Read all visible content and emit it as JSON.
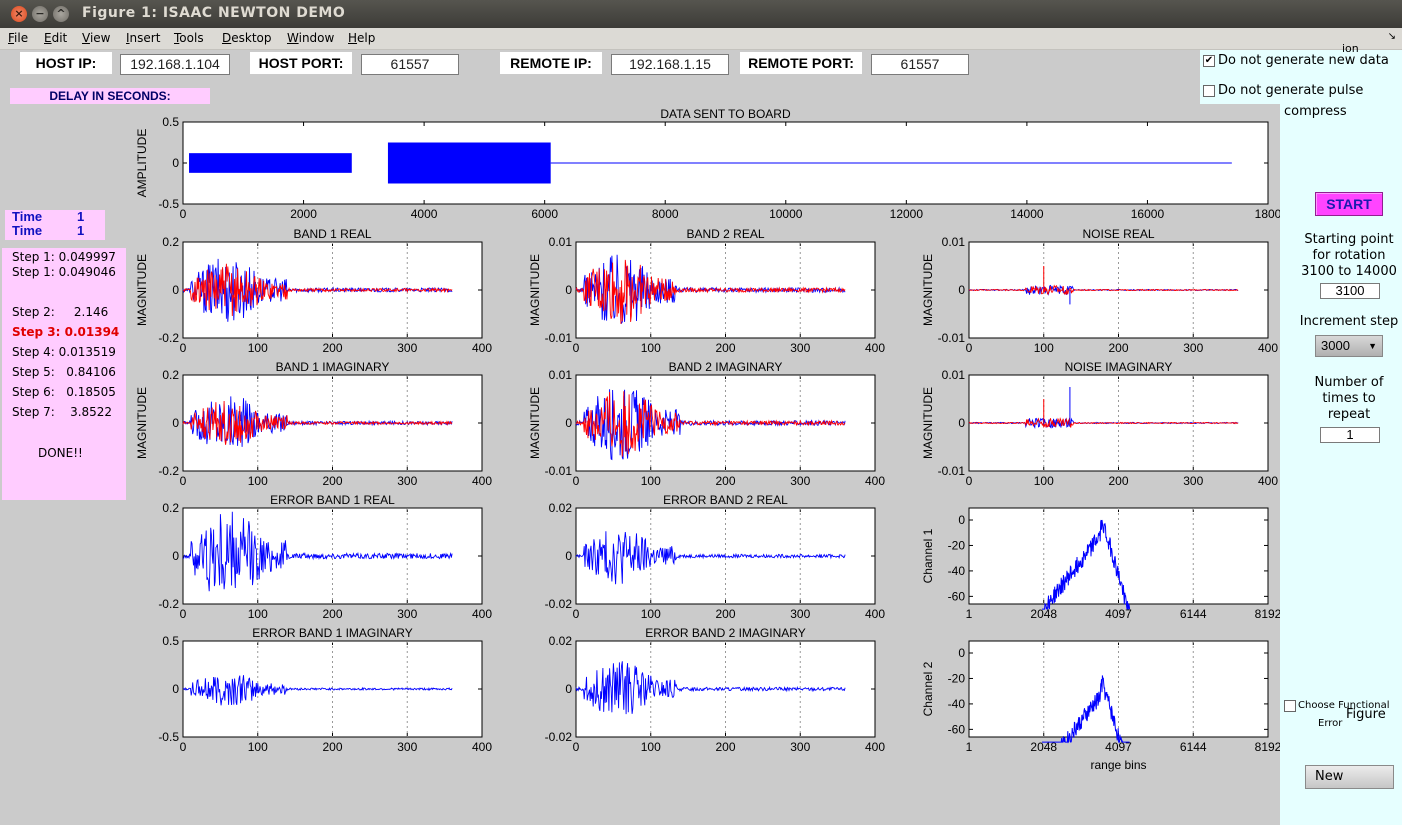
{
  "window": {
    "title": "Figure 1:  ISAAC NEWTON DEMO"
  },
  "menu": [
    "File",
    "Edit",
    "View",
    "Insert",
    "Tools",
    "Desktop",
    "Window",
    "Help"
  ],
  "network": {
    "host_ip_label": "HOST IP:",
    "host_ip": "192.168.1.104",
    "host_port_label": "HOST PORT:",
    "host_port": "61557",
    "remote_ip_label": "REMOTE IP:",
    "remote_ip": "192.168.1.15",
    "remote_port_label": "REMOTE PORT:",
    "remote_port": "61557"
  },
  "delay_label": "DELAY IN SECONDS:",
  "time": [
    {
      "label": "Time",
      "value": "1"
    },
    {
      "label": "Time",
      "value": "1"
    }
  ],
  "steps": [
    "Step 1: 0.049997",
    "Step 1: 0.049046",
    "Step 2:     2.146",
    "Step 3: 0.01394",
    "Step 4: 0.013519",
    "Step 5:   0.84106",
    "Step 6:   0.18505",
    "Step 7:    3.8522"
  ],
  "done": "DONE!!",
  "options": {
    "no_new_data": "Do not generate new data",
    "no_new_data_checked": true,
    "no_pulse": "Do not generate pulse",
    "no_pulse_checked": false,
    "compress": "compress",
    "clipped_top": "ion"
  },
  "controls": {
    "start": "START",
    "start_point_label": [
      "Starting point",
      "for rotation",
      "3100 to 14000"
    ],
    "start_point_value": "3100",
    "increment_label": "Increment step",
    "increment_value": "3000",
    "repeat_label": [
      "Number of",
      "times to",
      "repeat"
    ],
    "repeat_value": "1",
    "choose_error_label": "Choose Functional",
    "choose_error_label2": "Error",
    "figure_label": "Figure",
    "new": "New"
  },
  "chart_data": [
    {
      "type": "line",
      "title": "DATA SENT TO BOARD",
      "ylabel": "AMPLITUDE",
      "xlim": [
        0,
        18000
      ],
      "ylim": [
        -0.5,
        0.5
      ],
      "xticks": [
        "0",
        "2000",
        "4000",
        "6000",
        "8000",
        "10000",
        "12000",
        "14000",
        "16000",
        "1800"
      ],
      "yticks": [
        "0.5",
        "0",
        "-0.5"
      ],
      "series": [
        {
          "color": "#0000ff",
          "segments": [
            {
              "x": [
                100,
                2800
              ],
              "amp": 0.12
            },
            {
              "x": [
                3400,
                6100
              ],
              "amp": 0.25
            },
            {
              "x": [
                6100,
                17400
              ],
              "amp": 0.0
            }
          ]
        }
      ]
    },
    {
      "type": "line",
      "title": "BAND 1 REAL",
      "ylabel": "MAGNITUDE",
      "xlim": [
        0,
        400
      ],
      "ylim": [
        -0.2,
        0.2
      ],
      "xticks": [
        "0",
        "100",
        "200",
        "300",
        "400"
      ],
      "yticks": [
        "0.2",
        "0",
        "-0.2"
      ],
      "red_scale": 0.8,
      "burst_end": 140,
      "peak": 0.14
    },
    {
      "type": "line",
      "title": "BAND 2 REAL",
      "ylabel": "MAGNITUDE",
      "xlim": [
        0,
        400
      ],
      "ylim": [
        -0.01,
        0.01
      ],
      "xticks": [
        "0",
        "100",
        "200",
        "300",
        "400"
      ],
      "yticks": [
        "0.01",
        "0",
        "-0.01"
      ],
      "red_scale": 0.9,
      "burst_end": 135,
      "peak": 0.008
    },
    {
      "type": "line",
      "title": "NOISE REAL",
      "ylabel": "MAGNITUDE",
      "xlim": [
        0,
        400
      ],
      "ylim": [
        -0.01,
        0.01
      ],
      "xticks": [
        "0",
        "100",
        "200",
        "300",
        "400"
      ],
      "yticks": [
        "0.01",
        "0",
        "-0.01"
      ],
      "red_scale": 1.0,
      "burst_end": 0,
      "peak": 0.002
    },
    {
      "type": "line",
      "title": "BAND 1 IMAGINARY",
      "ylabel": "MAGNITUDE",
      "xlim": [
        0,
        400
      ],
      "ylim": [
        -0.2,
        0.2
      ],
      "xticks": [
        "0",
        "100",
        "200",
        "300",
        "400"
      ],
      "yticks": [
        "0.2",
        "0",
        "-0.2"
      ],
      "red_scale": 0.8,
      "burst_end": 140,
      "peak": 0.12
    },
    {
      "type": "line",
      "title": "BAND 2 IMAGINARY",
      "ylabel": "MAGNITUDE",
      "xlim": [
        0,
        400
      ],
      "ylim": [
        -0.01,
        0.01
      ],
      "xticks": [
        "0",
        "100",
        "200",
        "300",
        "400"
      ],
      "yticks": [
        "0.01",
        "0",
        "-0.01"
      ],
      "red_scale": 0.9,
      "burst_end": 140,
      "peak": 0.008
    },
    {
      "type": "line",
      "title": "NOISE IMAGINARY",
      "ylabel": "MAGNITUDE",
      "xlim": [
        0,
        400
      ],
      "ylim": [
        -0.01,
        0.01
      ],
      "xticks": [
        "0",
        "100",
        "200",
        "300",
        "400"
      ],
      "yticks": [
        "0.01",
        "0",
        "-0.01"
      ],
      "red_scale": 1.0,
      "burst_end": 0,
      "peak": 0.002
    },
    {
      "type": "line",
      "title": "ERROR BAND 1 REAL",
      "ylabel": "",
      "xlim": [
        0,
        400
      ],
      "ylim": [
        -0.2,
        0.2
      ],
      "xticks": [
        "0",
        "100",
        "200",
        "300",
        "400"
      ],
      "yticks": [
        "0.2",
        "0",
        "-0.2"
      ],
      "red_scale": 0,
      "burst_end": 140,
      "peak": 0.19
    },
    {
      "type": "line",
      "title": "ERROR BAND 2 REAL",
      "ylabel": "",
      "xlim": [
        0,
        400
      ],
      "ylim": [
        -0.02,
        0.02
      ],
      "xticks": [
        "0",
        "100",
        "200",
        "300",
        "400"
      ],
      "yticks": [
        "0.02",
        "0",
        "-0.02"
      ],
      "red_scale": 0,
      "burst_end": 135,
      "peak": 0.012
    },
    {
      "type": "line",
      "title": "Channel 1",
      "ylabel": "Channel 1",
      "xlim": [
        1,
        8192
      ],
      "ylim": [
        -70,
        5
      ],
      "xticks": [
        "1",
        "2048",
        "4097",
        "6144",
        "8192"
      ],
      "yticks": [
        "0",
        "-20",
        "-40",
        "-60"
      ],
      "spectrum": true
    },
    {
      "type": "line",
      "title": "ERROR BAND 1 IMAGINARY",
      "ylabel": "",
      "xlim": [
        0,
        400
      ],
      "ylim": [
        -0.5,
        0.5
      ],
      "xticks": [
        "0",
        "100",
        "200",
        "300",
        "400"
      ],
      "yticks": [
        "0.5",
        "0",
        "-0.5"
      ],
      "red_scale": 0,
      "burst_end": 140,
      "peak": 0.18
    },
    {
      "type": "line",
      "title": "ERROR BAND 2 IMAGINARY",
      "ylabel": "",
      "xlim": [
        0,
        400
      ],
      "ylim": [
        -0.02,
        0.02
      ],
      "xticks": [
        "0",
        "100",
        "200",
        "300",
        "400"
      ],
      "yticks": [
        "0.02",
        "0",
        "-0.02"
      ],
      "red_scale": 0,
      "burst_end": 135,
      "peak": 0.012
    },
    {
      "type": "line",
      "title": "Channel 2",
      "ylabel": "Channel 2",
      "xlabel": "range bins",
      "xlim": [
        1,
        8192
      ],
      "ylim": [
        -70,
        5
      ],
      "xticks": [
        "1",
        "2048",
        "4097",
        "6144",
        "8192"
      ],
      "yticks": [
        "0",
        "-20",
        "-40",
        "-60"
      ],
      "spectrum": true
    }
  ]
}
